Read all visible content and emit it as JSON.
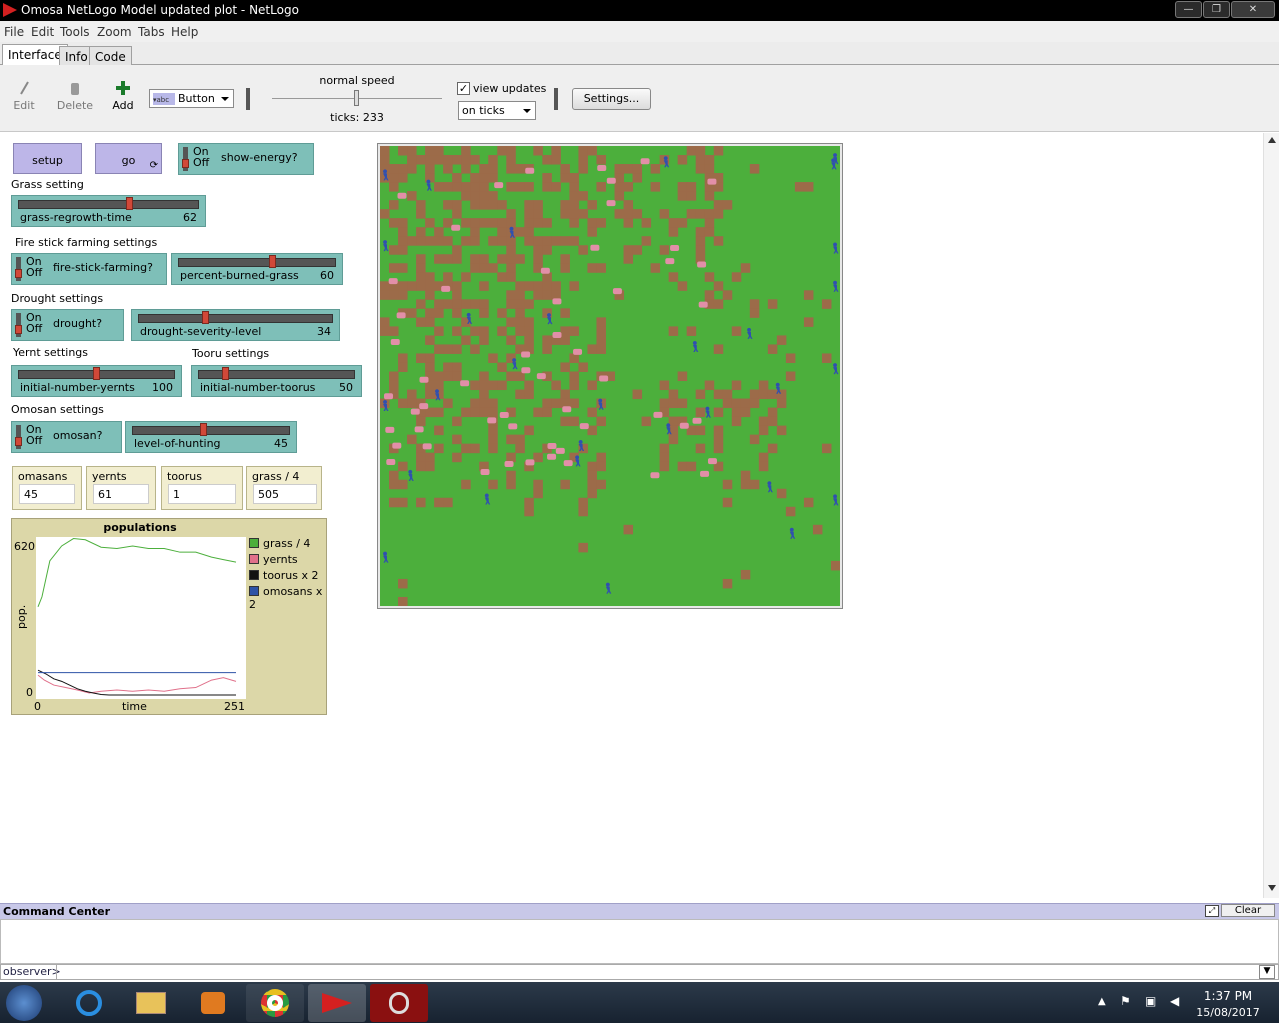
{
  "window": {
    "title": "Omosa NetLogo Model updated plot - NetLogo",
    "buttons": {
      "minimize": "—",
      "restore": "❐",
      "close": "✕"
    }
  },
  "menu": [
    "File",
    "Edit",
    "Tools",
    "Zoom",
    "Tabs",
    "Help"
  ],
  "tabs": [
    "Interface",
    "Info",
    "Code"
  ],
  "toolbar": {
    "edit": "Edit",
    "delete": "Delete",
    "add": "Add",
    "widget_kind": "Button",
    "speed_label": "normal speed",
    "speed_level": 0.5,
    "ticks": "ticks: 233",
    "view_updates_label": "view updates",
    "view_updates_checked": true,
    "update_mode": "on ticks",
    "settings": "Settings..."
  },
  "buttons": {
    "setup": "setup",
    "go": "go"
  },
  "switch_text": {
    "on": "On",
    "off": "Off"
  },
  "switches": {
    "show_energy": "show-energy?",
    "fire_stick": "fire-stick-farming?",
    "drought": "drought?",
    "omosan": "omosan?"
  },
  "notes": {
    "grass": "Grass setting",
    "fire": "Fire stick farming settings",
    "drought": "Drought settings",
    "yernt": "Yernt settings",
    "tooru": "Tooru settings",
    "omosan": "Omosan settings"
  },
  "sliders": {
    "grass_regrowth": {
      "name": "grass-regrowth-time",
      "value": "62",
      "fraction": 0.62
    },
    "percent_burned": {
      "name": "percent-burned-grass",
      "value": "60",
      "fraction": 0.6
    },
    "drought_severity": {
      "name": "drought-severity-level",
      "value": "34",
      "fraction": 0.34
    },
    "initial_yernts": {
      "name": "initial-number-yernts",
      "value": "100",
      "fraction": 0.5
    },
    "initial_toorus": {
      "name": "initial-number-toorus",
      "value": "50",
      "fraction": 0.16
    },
    "hunting": {
      "name": "level-of-hunting",
      "value": "45",
      "fraction": 0.45
    }
  },
  "monitors": [
    {
      "name": "omasans",
      "value": "45"
    },
    {
      "name": "yernts",
      "value": "61"
    },
    {
      "name": "toorus",
      "value": "1"
    },
    {
      "name": "grass / 4",
      "value": "505"
    }
  ],
  "chart_data": {
    "type": "line",
    "title": "populations",
    "xlabel": "time",
    "ylabel": "pop.",
    "xlim": [
      0,
      251
    ],
    "ylim": [
      0,
      620
    ],
    "x_tick_labels": [
      "0",
      "251"
    ],
    "y_tick_labels": [
      "0",
      "620"
    ],
    "legend_position": "right",
    "series": [
      {
        "name": "grass / 4",
        "color": "#4caf3c",
        "x": [
          0,
          5,
          15,
          30,
          45,
          60,
          80,
          100,
          120,
          140,
          160,
          180,
          200,
          220,
          235,
          251
        ],
        "y": [
          355,
          395,
          540,
          600,
          630,
          625,
          595,
          590,
          600,
          590,
          590,
          575,
          575,
          555,
          545,
          535
        ]
      },
      {
        "name": "yernts",
        "color": "#e0708a",
        "x": [
          0,
          8,
          20,
          35,
          50,
          65,
          80,
          100,
          120,
          140,
          160,
          180,
          200,
          210,
          220,
          235,
          251
        ],
        "y": [
          80,
          60,
          40,
          30,
          20,
          8,
          15,
          20,
          15,
          20,
          15,
          25,
          30,
          45,
          60,
          70,
          55
        ]
      },
      {
        "name": "toorus x 2",
        "color": "#111111",
        "x": [
          0,
          10,
          20,
          30,
          40,
          50,
          60,
          70,
          80,
          90,
          251
        ],
        "y": [
          100,
          85,
          65,
          55,
          40,
          25,
          15,
          8,
          2,
          0,
          0
        ]
      },
      {
        "name": "omosans x 2",
        "color": "#2d52a6",
        "x": [
          0,
          251
        ],
        "y": [
          90,
          90
        ]
      }
    ]
  },
  "world": {
    "grass_color": "#4caf3c",
    "dirt_color": "#9c6b49",
    "yernt_color": "#e28fa8",
    "tooru_color": "#3050b0"
  },
  "command_center": {
    "title": "Command Center",
    "clear": "Clear",
    "prompt": "observer>"
  },
  "taskbar": {
    "time": "1:37 PM",
    "date": "15/08/2017"
  }
}
